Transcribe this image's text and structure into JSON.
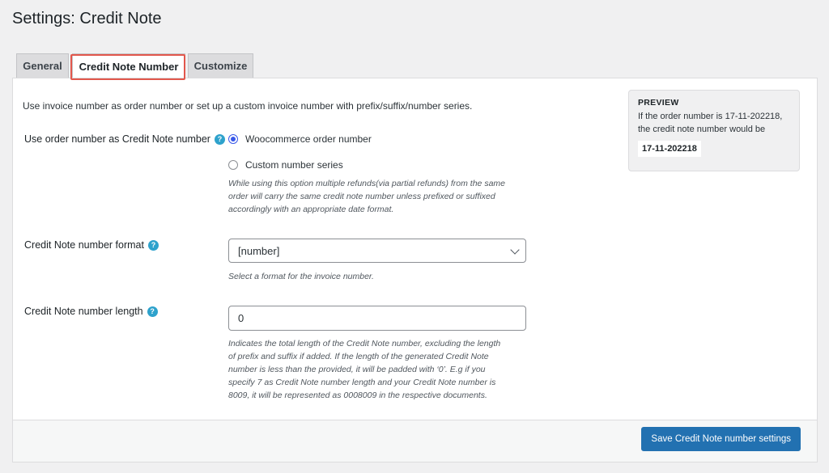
{
  "page": {
    "title": "Settings: Credit Note"
  },
  "tabs": [
    {
      "label": "General"
    },
    {
      "label": "Credit Note Number"
    },
    {
      "label": "Customize"
    }
  ],
  "intro": "Use invoice number as order number or set up a custom invoice number with prefix/suffix/number series.",
  "use_order_number": {
    "label": "Use order number as Credit Note number",
    "options": [
      {
        "label": "Woocommerce order number",
        "checked": true
      },
      {
        "label": "Custom number series",
        "checked": false
      }
    ],
    "description": [
      "While using this option multiple refunds(via partial refunds) from the same",
      "order will carry the same credit note number unless prefixed or suffixed",
      "accordingly with an appropriate date format."
    ]
  },
  "number_format": {
    "label": "Credit Note number format",
    "selected": "[number]",
    "description": "Select a format for the invoice number."
  },
  "number_length": {
    "label": "Credit Note number length",
    "value": "0",
    "description": [
      "Indicates the total length of the Credit Note number, excluding the length",
      "of prefix and suffix if added. If the length of the generated Credit Note",
      "number is less than the provided, it will be padded with ‘0’. E.g if you",
      "specify 7 as Credit Note number length and your Credit Note number is",
      "8009, it will be represented as 0008009 in the respective documents."
    ]
  },
  "preview": {
    "title": "PREVIEW",
    "line1": "If the order number is 17-11-202218,",
    "line2": "the credit note number would be",
    "value": "17-11-202218"
  },
  "footer": {
    "save_label": "Save Credit Note number settings"
  },
  "help_glyph": "?",
  "colors": {
    "accent": "#2271b1",
    "highlight": "#e2574c",
    "help": "#2ea2cc"
  }
}
